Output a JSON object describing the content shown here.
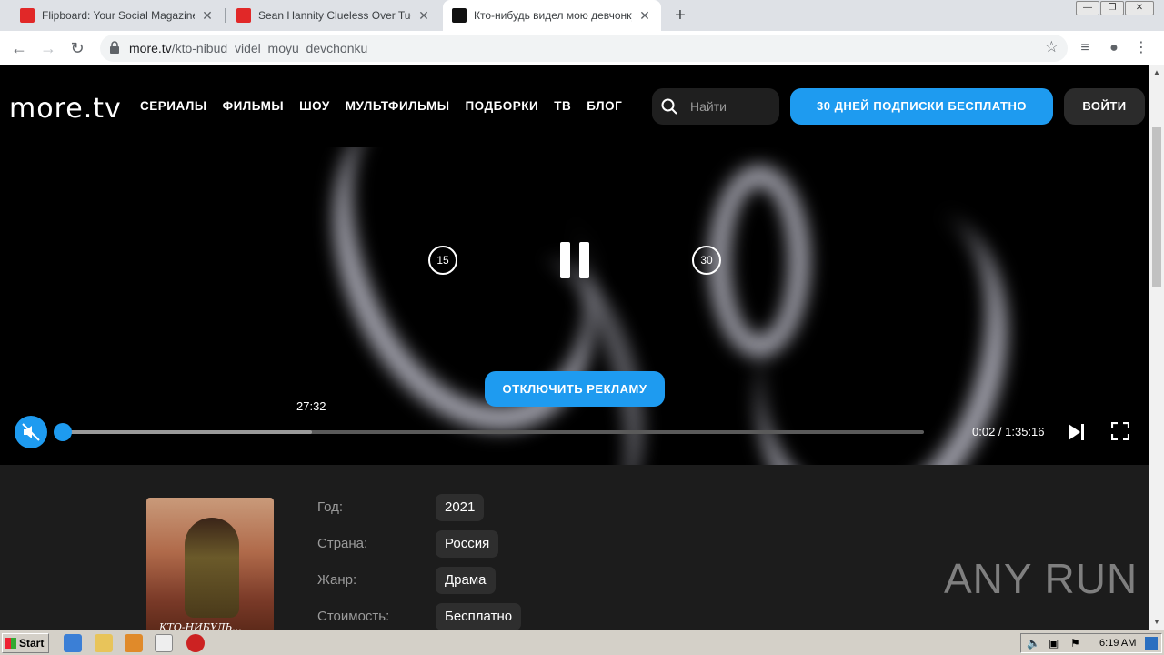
{
  "browser": {
    "tabs": [
      {
        "title": "Flipboard: Your Social Magazine",
        "favicon_color": "#e12828",
        "active": false
      },
      {
        "title": "Sean Hannity Clueless Over Tucker Ca",
        "favicon_color": "#e12828",
        "active": false
      },
      {
        "title": "Кто-нибудь видел мою девчонку? смотр",
        "favicon_color": "#111111",
        "active": true
      }
    ],
    "url_host": "more.tv",
    "url_path": "/kto-nibud_videl_moyu_devchonku"
  },
  "site": {
    "logo": "more.tv",
    "nav": [
      "СЕРИАЛЫ",
      "ФИЛЬМЫ",
      "ШОУ",
      "МУЛЬТФИЛЬМЫ",
      "ПОДБОРКИ",
      "ТВ",
      "БЛОГ"
    ],
    "search_placeholder": "Найти",
    "promo_label": "30 ДНЕЙ ПОДПИСКИ БЕСПЛАТНО",
    "login_label": "ВОЙТИ",
    "accent_color": "#1e9bf0"
  },
  "player": {
    "rewind_label": "15",
    "forward_label": "30",
    "disable_ads_label": "ОТКЛЮЧИТЬ РЕКЛАМУ",
    "hover_time": "27:32",
    "time_display": "0:02 / 1:35:16",
    "progress_fraction": 0.0003,
    "buffered_fraction": 0.29,
    "muted": true
  },
  "movie": {
    "poster_title": "КТО-НИБУДЬ...",
    "meta": [
      {
        "label": "Год:",
        "value": "2021"
      },
      {
        "label": "Страна:",
        "value": "Россия"
      },
      {
        "label": "Жанр:",
        "value": "Драма"
      },
      {
        "label": "Стоимость:",
        "value": "Бесплатно"
      }
    ]
  },
  "watermark": "ANY RUN",
  "taskbar": {
    "start_label": "Start",
    "clock": "6:19 AM"
  }
}
